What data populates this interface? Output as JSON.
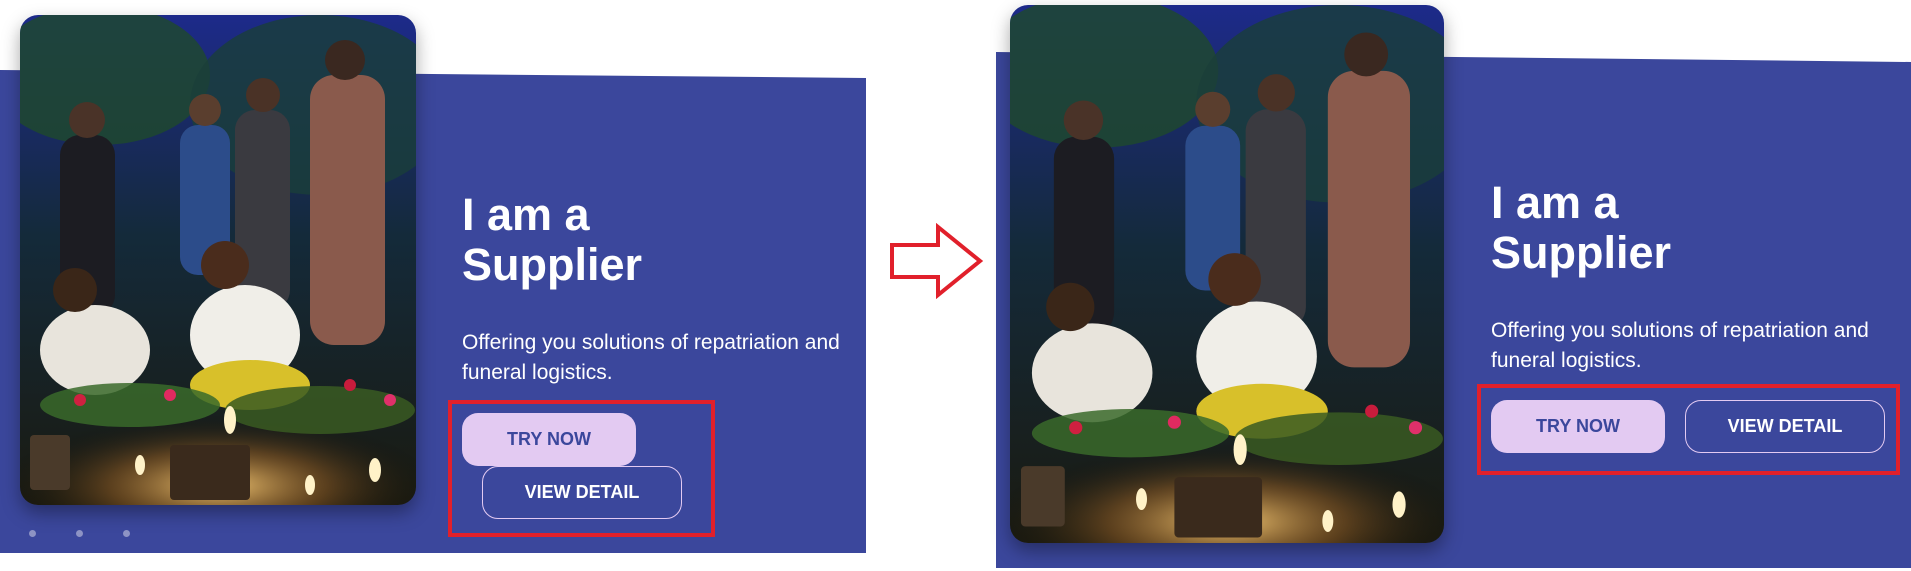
{
  "before": {
    "heading_line1": "I am a",
    "heading_line2": "Supplier",
    "description_line1": "Offering you solutions of repatriation and",
    "description_line2": "funeral logistics.",
    "try_now_label": "TRY NOW",
    "view_detail_label": "VIEW DETAIL"
  },
  "after": {
    "heading_line1": "I am a",
    "heading_line2": "Supplier",
    "description_line1": "Offering you solutions of repatriation and",
    "description_line2": "funeral logistics.",
    "try_now_label": "TRY NOW",
    "view_detail_label": "VIEW DETAIL"
  },
  "carousel": {
    "dot_count": 3
  },
  "colors": {
    "panel": "#3b479c",
    "button_primary": "#e3caf2",
    "highlight": "#e1202b"
  },
  "icons": {
    "transition": "arrow-right-icon"
  }
}
